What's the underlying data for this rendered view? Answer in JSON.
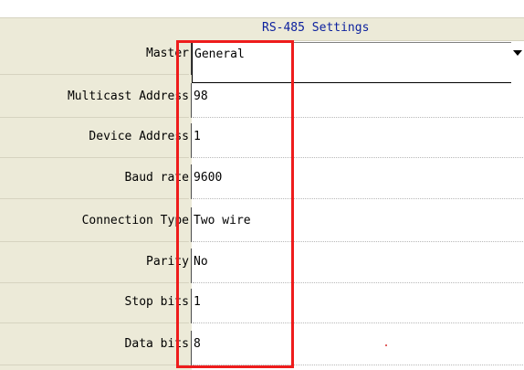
{
  "header": {
    "title": "RS-485 Settings"
  },
  "rows": [
    {
      "label": "Master",
      "value": "General"
    },
    {
      "label": "Multicast Address",
      "value": "98"
    },
    {
      "label": "Device Address",
      "value": "1"
    },
    {
      "label": "Baud rate",
      "value": "9600"
    },
    {
      "label": "Connection Type",
      "value": "Two wire"
    },
    {
      "label": "Parity",
      "value": "No"
    },
    {
      "label": "Stop bits",
      "value": "1"
    },
    {
      "label": "Data bits",
      "value": "8"
    }
  ],
  "colors": {
    "header_background": "#ecead8",
    "title_text": "#0a1f9e",
    "highlight_box": "#ee1c1c"
  },
  "icons": {
    "dropdown": "chevron-down-icon"
  }
}
